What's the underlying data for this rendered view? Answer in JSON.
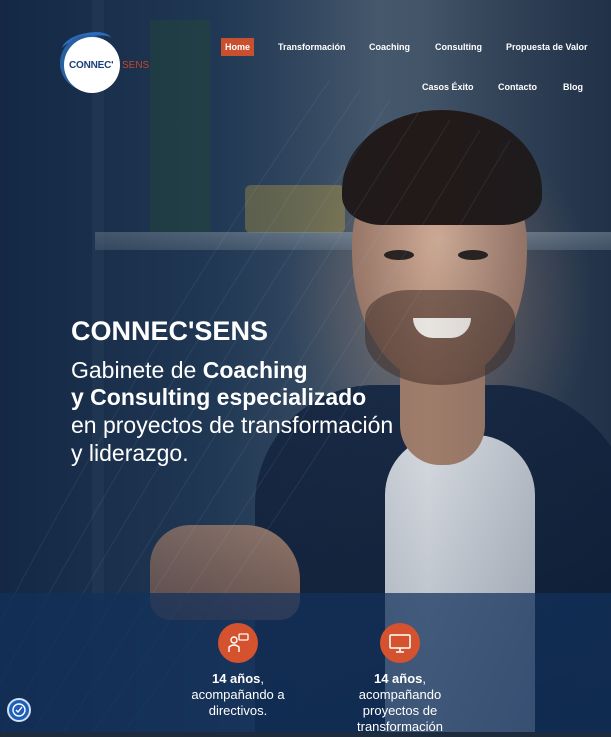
{
  "brand": {
    "logo_main": "CONNEC'",
    "logo_sub": "SENS"
  },
  "nav": {
    "items": [
      {
        "label": "Home",
        "active": true
      },
      {
        "label": "Transformación"
      },
      {
        "label": "Coaching"
      },
      {
        "label": "Consulting"
      },
      {
        "label": "Propuesta de Valor"
      },
      {
        "label": "Casos Éxito"
      },
      {
        "label": "Contacto"
      },
      {
        "label": "Blog"
      }
    ]
  },
  "hero": {
    "title": "CONNEC'SENS",
    "line1_pre": "Gabinete de ",
    "line1_bold": "Coaching",
    "line2_bold": "y Consulting especializado",
    "line3": "en proyectos de transformación",
    "line4": "y liderazgo."
  },
  "stats": [
    {
      "bold": "14 años",
      "suffix": ",",
      "lines": [
        "acompañando a",
        "directivos."
      ],
      "icon": "presenter-icon"
    },
    {
      "bold": "14 años",
      "suffix": ",",
      "lines": [
        "acompañando",
        "proyectos de",
        "transformación"
      ],
      "icon": "monitor-icon"
    }
  ],
  "colors": {
    "accent": "#c9502e",
    "band": "#12305c",
    "text": "#ffffff"
  },
  "accessibility": {
    "icon": "accessibility-icon"
  }
}
